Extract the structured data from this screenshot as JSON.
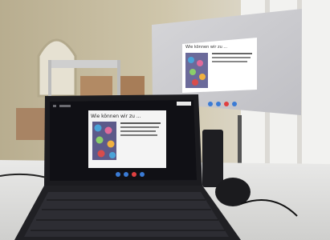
{
  "laptop": {
    "slide_title": "Wie können wir zu ..."
  },
  "projection": {
    "slide_title": "Wie können wir zu ..."
  },
  "colors": {
    "screen_glow": "#f4f4f4",
    "slide_bg": "#ffffff",
    "bezel": "#1b1b1f",
    "wall": "#cfc8b6",
    "floor": "#9c6a4a"
  }
}
